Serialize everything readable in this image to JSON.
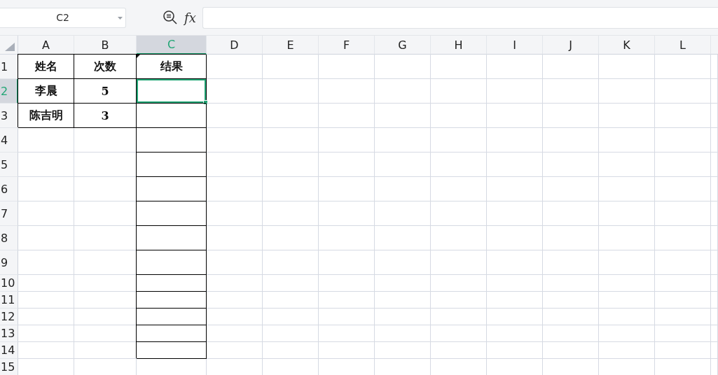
{
  "name_box": {
    "value": "C2"
  },
  "formula_bar": {
    "fx": "fx"
  },
  "columns": [
    {
      "label": "A",
      "selected": false
    },
    {
      "label": "B",
      "selected": false
    },
    {
      "label": "C",
      "selected": true
    },
    {
      "label": "D",
      "selected": false
    },
    {
      "label": "E",
      "selected": false
    },
    {
      "label": "F",
      "selected": false
    },
    {
      "label": "G",
      "selected": false
    },
    {
      "label": "H",
      "selected": false
    },
    {
      "label": "I",
      "selected": false
    },
    {
      "label": "J",
      "selected": false
    },
    {
      "label": "K",
      "selected": false
    },
    {
      "label": "L",
      "selected": false
    }
  ],
  "rows": [
    {
      "header": "1",
      "selected": false,
      "cells": [
        {
          "text": "姓名",
          "bordered": true,
          "selected": false,
          "flagged": false
        },
        {
          "text": "次数",
          "bordered": true,
          "selected": false,
          "flagged": false
        },
        {
          "text": "结果",
          "bordered": true,
          "selected": false,
          "flagged": true
        }
      ]
    },
    {
      "header": "2",
      "selected": true,
      "cells": [
        {
          "text": "李晨",
          "bordered": true,
          "selected": false,
          "flagged": false
        },
        {
          "text": "5",
          "bordered": true,
          "selected": false,
          "flagged": false
        },
        {
          "bordered": true,
          "selected": true,
          "flagged": false
        }
      ]
    },
    {
      "header": "3",
      "selected": false,
      "cells": [
        {
          "text": "陈吉明",
          "bordered": true,
          "selected": false,
          "flagged": false
        },
        {
          "text": "3",
          "bordered": true,
          "selected": false,
          "flagged": false
        },
        {
          "bordered": true,
          "selected": false,
          "flagged": false
        }
      ]
    },
    {
      "header": "4",
      "selected": false,
      "cells": [
        {
          "bordered": false,
          "selected": false,
          "flagged": false
        },
        {
          "bordered": false,
          "selected": false,
          "flagged": false
        },
        {
          "bordered": true,
          "selected": false,
          "flagged": false
        }
      ]
    },
    {
      "header": "5",
      "selected": false,
      "cells": [
        {
          "bordered": false,
          "selected": false,
          "flagged": false
        },
        {
          "bordered": false,
          "selected": false,
          "flagged": false
        },
        {
          "bordered": true,
          "selected": false,
          "flagged": false
        }
      ]
    },
    {
      "header": "6",
      "selected": false,
      "cells": [
        {
          "bordered": false,
          "selected": false,
          "flagged": false
        },
        {
          "bordered": false,
          "selected": false,
          "flagged": false
        },
        {
          "bordered": true,
          "selected": false,
          "flagged": false
        }
      ]
    },
    {
      "header": "7",
      "selected": false,
      "cells": [
        {
          "bordered": false,
          "selected": false,
          "flagged": false
        },
        {
          "bordered": false,
          "selected": false,
          "flagged": false
        },
        {
          "bordered": true,
          "selected": false,
          "flagged": false
        }
      ]
    },
    {
      "header": "8",
      "selected": false,
      "cells": [
        {
          "bordered": false,
          "selected": false,
          "flagged": false
        },
        {
          "bordered": false,
          "selected": false,
          "flagged": false
        },
        {
          "bordered": true,
          "selected": false,
          "flagged": false
        }
      ]
    },
    {
      "header": "9",
      "selected": false,
      "cells": [
        {
          "bordered": false,
          "selected": false,
          "flagged": false
        },
        {
          "bordered": false,
          "selected": false,
          "flagged": false
        },
        {
          "bordered": true,
          "selected": false,
          "flagged": false
        }
      ]
    },
    {
      "header": "10",
      "selected": false,
      "cells": [
        {
          "bordered": false,
          "selected": false,
          "flagged": false
        },
        {
          "bordered": false,
          "selected": false,
          "flagged": false
        },
        {
          "bordered": true,
          "selected": false,
          "flagged": false
        }
      ]
    },
    {
      "header": "11",
      "selected": false,
      "cells": [
        {
          "bordered": false,
          "selected": false,
          "flagged": false
        },
        {
          "bordered": false,
          "selected": false,
          "flagged": false
        },
        {
          "bordered": true,
          "selected": false,
          "flagged": false
        }
      ]
    },
    {
      "header": "12",
      "selected": false,
      "cells": [
        {
          "bordered": false,
          "selected": false,
          "flagged": false
        },
        {
          "bordered": false,
          "selected": false,
          "flagged": false
        },
        {
          "bordered": true,
          "selected": false,
          "flagged": false
        }
      ]
    },
    {
      "header": "13",
      "selected": false,
      "cells": [
        {
          "bordered": false,
          "selected": false,
          "flagged": false
        },
        {
          "bordered": false,
          "selected": false,
          "flagged": false
        },
        {
          "bordered": true,
          "selected": false,
          "flagged": false
        }
      ]
    },
    {
      "header": "14",
      "selected": false,
      "cells": [
        {
          "bordered": false,
          "selected": false,
          "flagged": false
        },
        {
          "bordered": false,
          "selected": false,
          "flagged": false
        },
        {
          "bordered": true,
          "selected": false,
          "flagged": false
        }
      ]
    },
    {
      "header": "15",
      "selected": false,
      "cells": [
        {
          "bordered": false,
          "selected": false,
          "flagged": false
        },
        {
          "bordered": false,
          "selected": false,
          "flagged": false
        },
        {
          "bordered": false,
          "selected": false,
          "flagged": false
        }
      ]
    }
  ]
}
